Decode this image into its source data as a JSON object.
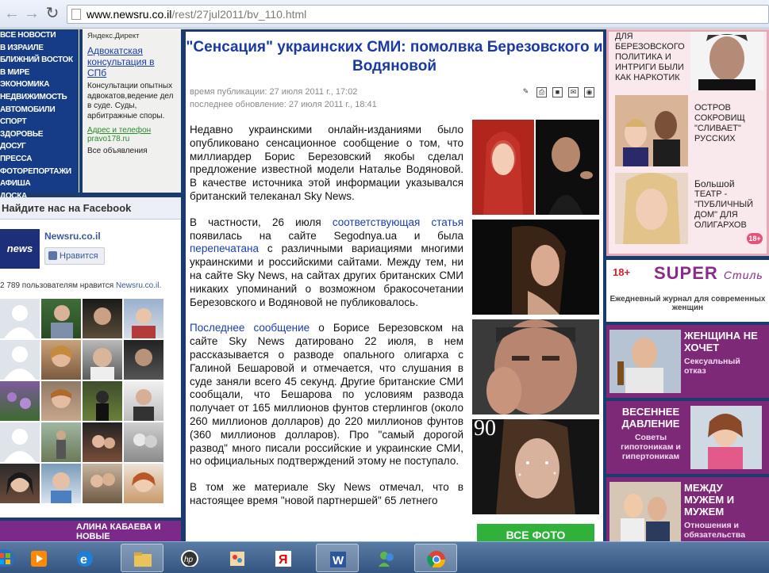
{
  "browser": {
    "url_host": "www.newsru.co.il",
    "url_path": "/rest/27jul2011/bv_110.html"
  },
  "left_nav": {
    "items": [
      "Все новости",
      "В Израиле",
      "Ближний Восток",
      "В мире",
      "Экономика",
      "Недвижимость",
      "Автомобили",
      "Спорт",
      "Здоровье",
      "Досуг",
      "Пресса",
      "Фоторепортажи",
      "Афиша",
      "Доска"
    ]
  },
  "direct": {
    "title": "Яндекс.Директ",
    "link": "Адвокатская консультация в СПб",
    "text": "Консультации опытных адвокатов,ведение дел в суде. Суды, арбитражные споры.",
    "address": "Адрес и телефон",
    "site": "pravo178.ru",
    "all": "Все объявления"
  },
  "facebook": {
    "heading": "Найдите нас на Facebook",
    "logo_text": "news",
    "page_name": "Newsru.co.il",
    "like_label": "Нравится",
    "count_text": "2 789 пользователям нравится ",
    "count_link": "Newsru.co.il.",
    "banner": "АЛИНА КАБАЕВА И НОВЫЕ"
  },
  "article": {
    "title": "\"Сенсация\" украинских СМИ: помолвка Березовского и Водяновой",
    "published": "время публикации: 27 июля 2011 г., 17:02",
    "updated": "последнее обновление: 27 июля 2011 г., 18:41",
    "p1": "Недавно украинскими онлайн-изданиями было опубликовано сенсационное сообщение о том, что миллиардер Борис Березовский якобы сделал предложение известной модели Наталье Водяновой. В качестве источника этой информации указывался британский телеканал Sky News.",
    "p2_a": "В частности, 26 июля ",
    "p2_link1": "соответствующая статья",
    "p2_b": " появилась на сайте Segodnya.ua и была ",
    "p2_link2": "перепечатана",
    "p2_c": " с различными вариациями многими украинскими и российскими сайтами. Между тем, ни на сайте Sky News, на сайтах других британских СМИ никаких упоминаний о возможном бракосочетании Березовского и Водяновой не публиковалось.",
    "p3_link": "Последнее сообщение",
    "p3_b": " о Борисе Березовском на сайте Sky News датировано 22 июля, в нем рассказывается о разводе опального олигарха с Галиной Бешаровой и отмечается, что слушания в суде заняли всего 45 секунд. Другие британские СМИ сообщали, что Бешарова по условиям развода получает от 165 миллионов фунтов стерлингов (около 260 миллионов долларов) до 220 миллионов фунтов (360 миллионов долларов). Про \"самый дорогой развод\" много писали российские и украинские СМИ, но официальных подтверждений этому не поступало.",
    "p4": "В том же материале Sky News отмечал, что в настоящее время \"новой партнершей\" 65 летнего",
    "photo_overlay": "90",
    "all_photos": "ВСЕ ФОТО"
  },
  "right": {
    "promo1": "Для Березовского политика и интриги были как наркотик",
    "promo2": "Остров Сокровищ \"сливает\" русских",
    "promo3_big": "Большой",
    "promo3": "театр - \"публичный дом\" для олигархов",
    "age": "18+",
    "super_age": "18+",
    "super_name": "SUPER",
    "super_name2": "Стиль",
    "super_sub": "Ежедневный журнал для современных женщин",
    "ad1_title": "ЖЕНЩИНА НЕ ХОЧЕТ",
    "ad1_sub": "Сексуальный отказ",
    "ad2_title": "ВЕСЕННЕЕ ДАВЛЕНИЕ",
    "ad2_sub": "Советы гипотоникам и гипертоникам",
    "ad3_title": "МЕЖДУ МУЖЕМ И МУЖЕМ",
    "ad3_sub": "Отношения и обязательства"
  },
  "taskbar": {
    "apps": [
      "start-button",
      "media-player-icon",
      "internet-explorer-icon",
      "file-explorer-icon",
      "hp-icon",
      "paint-icon",
      "yandex-icon",
      "word-icon",
      "messenger-icon",
      "chrome-icon"
    ]
  }
}
